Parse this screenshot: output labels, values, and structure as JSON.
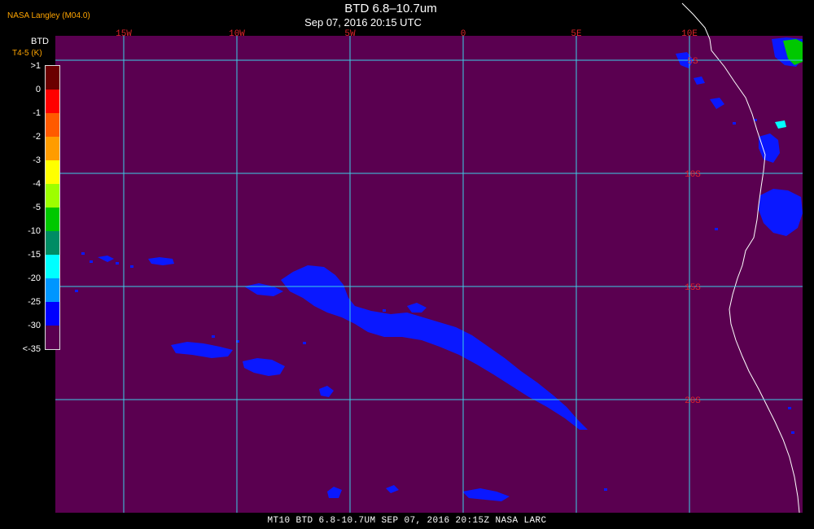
{
  "header": {
    "credit": "NASA Langley (M04.0)",
    "title": "BTD 6.8–10.7um",
    "subtitle": "Sep 07, 2016 20:15 UTC"
  },
  "colorbar": {
    "title": "BTD",
    "unit": "T4-5 (K)",
    "labels": [
      ">1",
      "0",
      "-1",
      "-2",
      "-3",
      "-4",
      "-5",
      "-10",
      "-15",
      "-20",
      "-25",
      "-30",
      "<-35"
    ],
    "colors": [
      "#6b0000",
      "#ff0000",
      "#ff5a00",
      "#ff9c00",
      "#ffff00",
      "#9dff00",
      "#00c800",
      "#008c64",
      "#00ffff",
      "#0096ff",
      "#0000ff",
      "#5a0050"
    ]
  },
  "map": {
    "background_color": "#5a0050",
    "grid_color": "#3ccfe6",
    "feature_color": "#0a18ff",
    "lon_labels": [
      "15W",
      "10W",
      "5W",
      "0",
      "5E",
      "10E"
    ],
    "lat_labels": [
      "5S",
      "10S",
      "15S",
      "20S"
    ]
  },
  "footer": {
    "text": "MT10  BTD 6.8-10.7UM   SEP 07, 2016 20:15Z   NASA LARC"
  }
}
